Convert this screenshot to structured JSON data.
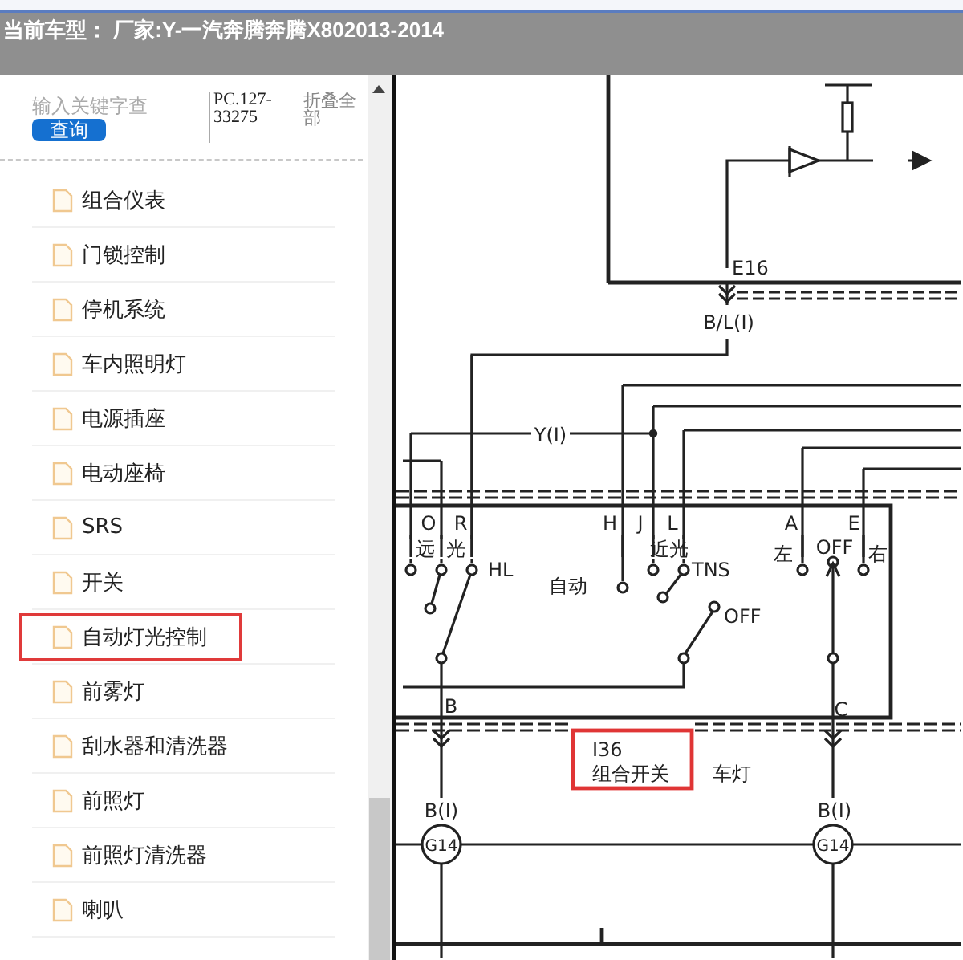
{
  "header": {
    "title": "当前车型： 厂家:Y-一汽奔腾奔腾X802013-2014"
  },
  "sidebar": {
    "search": {
      "placeholder": "输入关键字查"
    },
    "search_button": "查询",
    "code": "PC.127-33275",
    "collapse_all": "折叠全部",
    "items": [
      {
        "label": "组合仪表",
        "selected": false
      },
      {
        "label": "门锁控制",
        "selected": false
      },
      {
        "label": "停机系统",
        "selected": false
      },
      {
        "label": "车内照明灯",
        "selected": false
      },
      {
        "label": "电源插座",
        "selected": false
      },
      {
        "label": "电动座椅",
        "selected": false
      },
      {
        "label": "SRS",
        "selected": false
      },
      {
        "label": "开关",
        "selected": false
      },
      {
        "label": "自动灯光控制",
        "selected": true
      },
      {
        "label": "前雾灯",
        "selected": false
      },
      {
        "label": "刮水器和清洗器",
        "selected": false
      },
      {
        "label": "前照灯",
        "selected": false
      },
      {
        "label": "前照灯清洗器",
        "selected": false
      },
      {
        "label": "喇叭",
        "selected": false
      }
    ]
  },
  "diagram": {
    "labels": [
      "E16",
      "B/L(I)",
      "Y(I)",
      "O",
      "R",
      "远",
      "光",
      "HL",
      "H",
      "J",
      "L",
      "近光",
      "自动",
      "TNS",
      "OFF",
      "A",
      "E",
      "左",
      "OFF",
      "右",
      "B",
      "C",
      "I36",
      "组合开关",
      "车灯",
      "B(I)",
      "B(I)",
      "G14",
      "G14"
    ]
  }
}
